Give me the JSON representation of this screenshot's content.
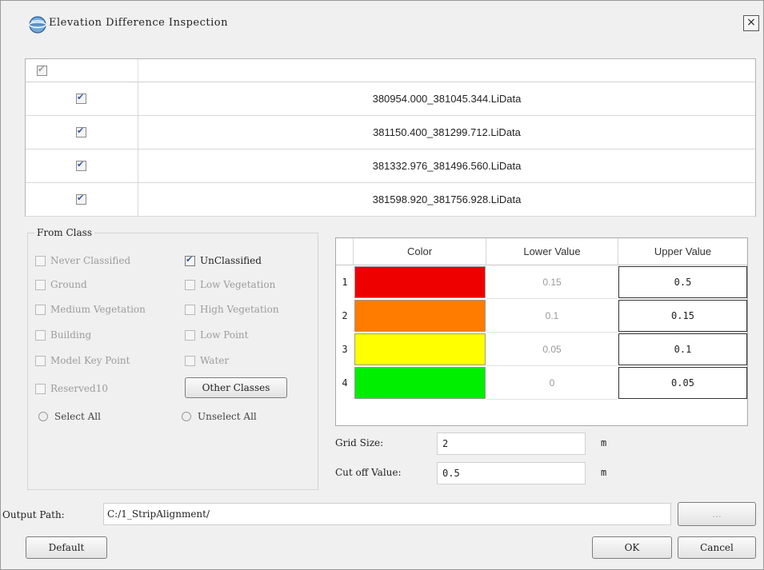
{
  "window": {
    "title": "Elevation Difference Inspection",
    "icon": "globe-icon",
    "close_label": "×"
  },
  "files": {
    "rows": [
      {
        "name": "380954.000_381045.344.LiData",
        "checked": true
      },
      {
        "name": "381150.400_381299.712.LiData",
        "checked": true
      },
      {
        "name": "381332.976_381496.560.LiData",
        "checked": true
      },
      {
        "name": "381598.920_381756.928.LiData",
        "checked": true
      }
    ]
  },
  "from_class": {
    "title": "From Class",
    "items": [
      {
        "label": "Never Classified",
        "checked": false,
        "enabled": false
      },
      {
        "label": "UnClassified",
        "checked": true,
        "enabled": true
      },
      {
        "label": "Ground",
        "checked": false,
        "enabled": false
      },
      {
        "label": "Low Vegetation",
        "checked": false,
        "enabled": false
      },
      {
        "label": "Medium Vegetation",
        "checked": false,
        "enabled": false
      },
      {
        "label": "High Vegetation",
        "checked": false,
        "enabled": false
      },
      {
        "label": "Building",
        "checked": false,
        "enabled": false
      },
      {
        "label": "Low Point",
        "checked": false,
        "enabled": false
      },
      {
        "label": "Model Key Point",
        "checked": false,
        "enabled": false
      },
      {
        "label": "Water",
        "checked": false,
        "enabled": false
      },
      {
        "label": "Reserved10",
        "checked": false,
        "enabled": false
      }
    ],
    "other_classes_label": "Other Classes",
    "select_all_label": "Select All",
    "unselect_all_label": "Unselect All"
  },
  "color_table": {
    "headers": [
      "Color",
      "Lower Value",
      "Upper Value"
    ],
    "rows": [
      {
        "num": "1",
        "color": "#ee0000",
        "lower": "0.15",
        "upper": "0.5"
      },
      {
        "num": "2",
        "color": "#ff7c00",
        "lower": "0.1",
        "upper": "0.15"
      },
      {
        "num": "3",
        "color": "#ffff00",
        "lower": "0.05",
        "upper": "0.1"
      },
      {
        "num": "4",
        "color": "#00ee00",
        "lower": "0",
        "upper": "0.05"
      }
    ]
  },
  "grid_size": {
    "label": "Grid Size:",
    "value": "2",
    "unit": "m"
  },
  "cut_off": {
    "label": "Cut off Value:",
    "value": "0.5",
    "unit": "m"
  },
  "output": {
    "label": "Output Path:",
    "value": "C:/1_StripAlignment/",
    "browse_label": "..."
  },
  "buttons": {
    "default": "Default",
    "ok": "OK",
    "cancel": "Cancel"
  }
}
